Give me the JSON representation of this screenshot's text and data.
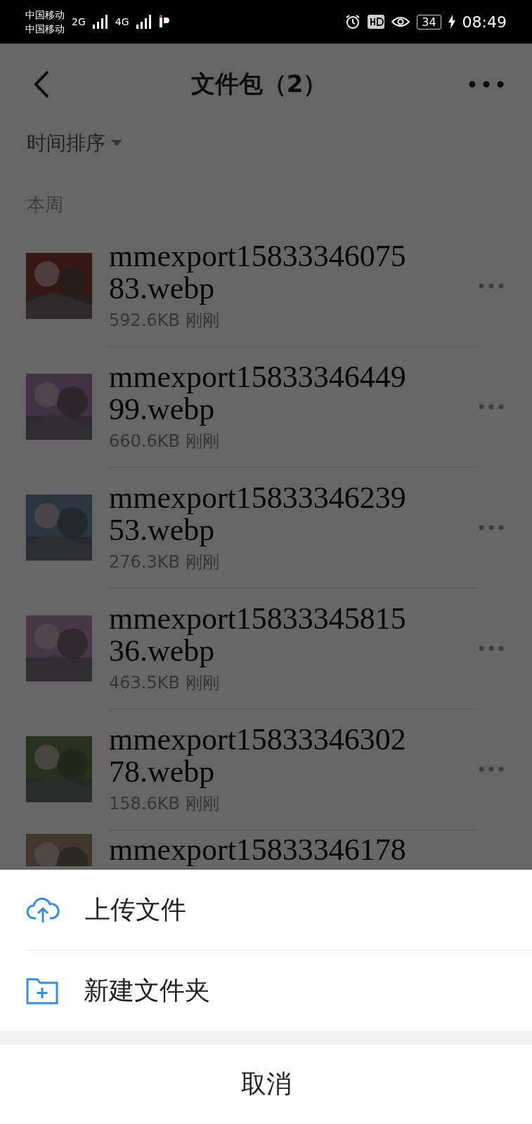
{
  "status_bar": {
    "carriers": [
      "中国移动",
      "中国移动"
    ],
    "networks": [
      "2G",
      "4G"
    ],
    "battery": "34",
    "time": "08:49"
  },
  "header": {
    "title": "文件包（2）"
  },
  "sort": {
    "label": "时间排序"
  },
  "section": {
    "title": "本周"
  },
  "files": [
    {
      "name": "mmexport1583334607583.webp",
      "size": "592.6KB",
      "time": "刚刚"
    },
    {
      "name": "mmexport1583334644999.webp",
      "size": "660.6KB",
      "time": "刚刚"
    },
    {
      "name": "mmexport1583334623953.webp",
      "size": "276.3KB",
      "time": "刚刚"
    },
    {
      "name": "mmexport1583334581536.webp",
      "size": "463.5KB",
      "time": "刚刚"
    },
    {
      "name": "mmexport1583334630278.webp",
      "size": "158.6KB",
      "time": "刚刚"
    },
    {
      "name": "mmexport15833346178"
    }
  ],
  "sheet": {
    "actions": [
      {
        "kind": "upload",
        "label": "上传文件"
      },
      {
        "kind": "folder",
        "label": "新建文件夹"
      }
    ],
    "cancel": "取消"
  }
}
